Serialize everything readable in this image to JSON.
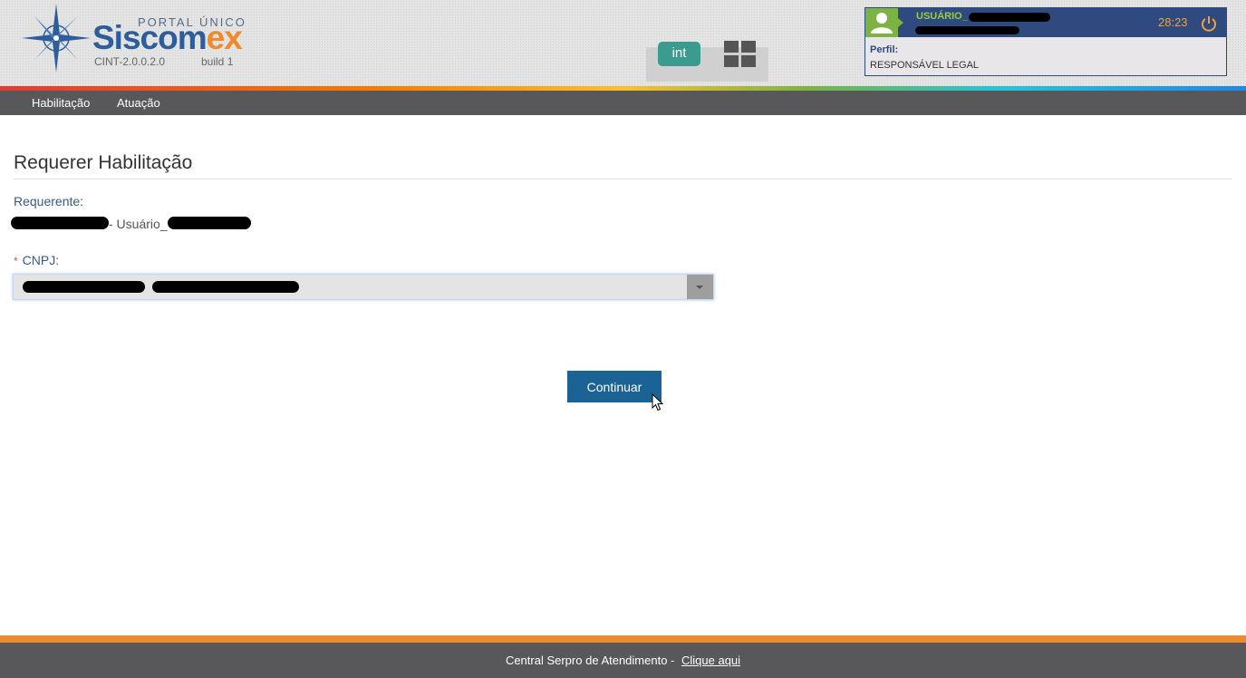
{
  "header": {
    "portal_label": "PORTAL ÚNICO",
    "brand_main": "Siscom",
    "brand_accent": "ex",
    "version": "CINT-2.0.0.2.0",
    "build": "build 1",
    "env_badge": "int"
  },
  "user": {
    "name_prefix": "USUÁRIO_",
    "timer": "28:23",
    "perfil_label": "Perfil:",
    "perfil_value": "RESPONSÁVEL LEGAL",
    "icons": {
      "avatar": "user-icon",
      "logout": "power-icon",
      "apps": "grid-icon"
    }
  },
  "nav": {
    "items": [
      {
        "label": "Habilitação"
      },
      {
        "label": "Atuação"
      }
    ]
  },
  "page": {
    "title": "Requerer Habilitação",
    "requerente_label": "Requerente:",
    "requerente_value": "- Usuário_",
    "cnpj_required_mark": "*",
    "cnpj_label": "CNPJ:",
    "continue_button": "Continuar"
  },
  "footer": {
    "text": "Central Serpro de Atendimento -",
    "link": "Clique aqui"
  },
  "colors": {
    "accent_orange": "#ee8b2c",
    "nav_bg": "#58585a",
    "button_bg": "#1b6394",
    "user_panel_bg": "#2f4a7e",
    "env_badge_bg": "#3a9b8e"
  }
}
